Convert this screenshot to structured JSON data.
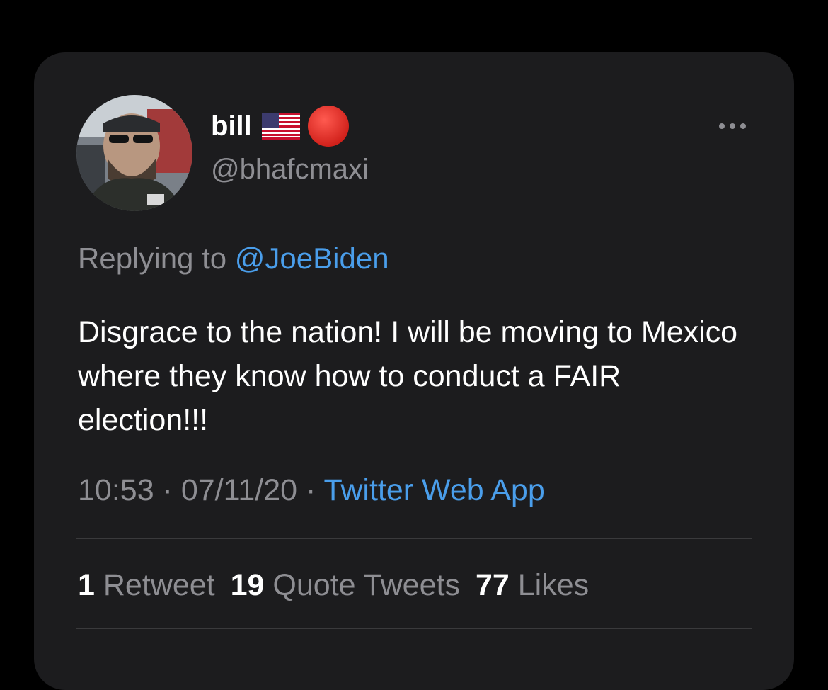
{
  "tweet": {
    "author": {
      "display_name": "bill",
      "handle": "@bhafcmaxi",
      "avatar_icon": "user-photo-avatar",
      "name_emojis": [
        "us-flag-icon",
        "red-circle-icon"
      ]
    },
    "reply": {
      "prefix": "Replying to ",
      "mention": "@JoeBiden"
    },
    "text": "Disgrace to the nation! I will be moving to Mexico where they know how to conduct a FAIR election!!!",
    "meta": {
      "time": "10:53",
      "separator1": " · ",
      "date": "07/11/20",
      "separator2": " · ",
      "source": "Twitter Web App"
    },
    "stats": {
      "retweets_count": "1",
      "retweets_label": "Retweet",
      "quotes_count": "19",
      "quotes_label": "Quote Tweets",
      "likes_count": "77",
      "likes_label": "Likes"
    }
  },
  "colors": {
    "background": "#000000",
    "card": "#1c1c1e",
    "text": "#ffffff",
    "secondary_text": "#8e8e93",
    "link": "#4a9eeb",
    "divider": "#3a3a3c"
  }
}
